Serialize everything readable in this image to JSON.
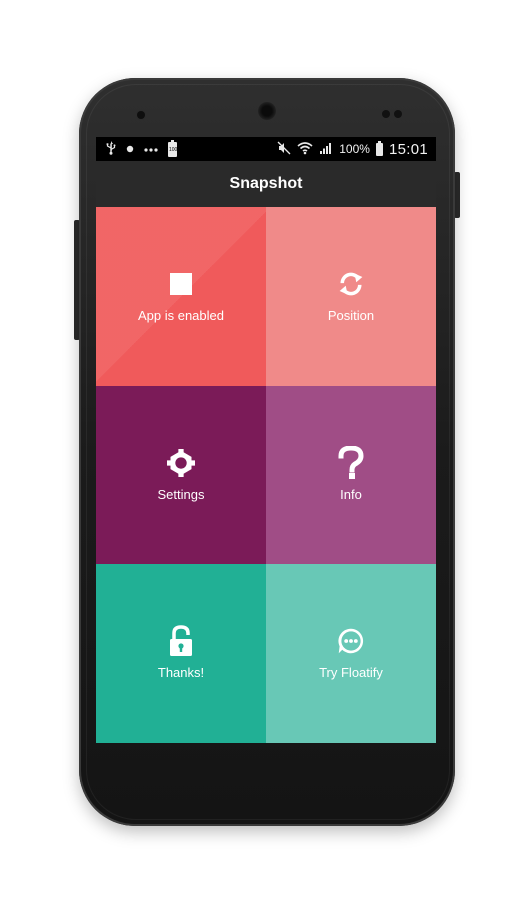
{
  "status_bar": {
    "left_icons": [
      "usb-icon",
      "notification-dot-icon",
      "more-dots-icon",
      "battery-100-icon"
    ],
    "battery_small_label": "100",
    "right_icons": [
      "mute-icon",
      "wifi-icon",
      "signal-icon",
      "battery-icon"
    ],
    "battery_percent": "100%",
    "time": "15:01"
  },
  "app_bar": {
    "title": "Snapshot"
  },
  "tiles": [
    {
      "label": "App is enabled",
      "icon": "stop-square-icon",
      "color": "#f05a5b"
    },
    {
      "label": "Position",
      "icon": "refresh-icon",
      "color": "#f08a89"
    },
    {
      "label": "Settings",
      "icon": "gear-icon",
      "color": "#7b1b58"
    },
    {
      "label": "Info",
      "icon": "question-icon",
      "color": "#a04d86"
    },
    {
      "label": "Thanks!",
      "icon": "unlock-icon",
      "color": "#21b095"
    },
    {
      "label": "Try Floatify",
      "icon": "chat-bubble-icon",
      "color": "#68c8b6"
    }
  ]
}
